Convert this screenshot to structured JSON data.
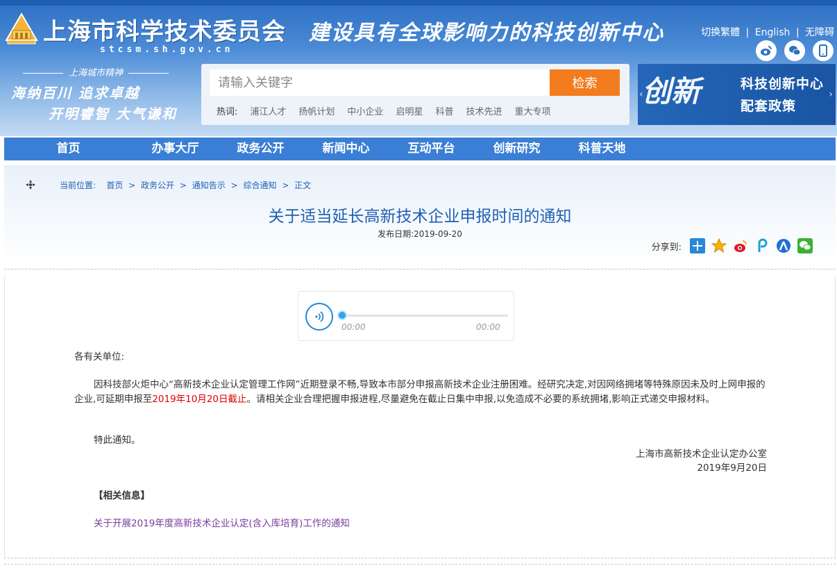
{
  "header": {
    "site_title": "上海市科学技术委员会",
    "site_url": "stcsm.sh.gov.cn",
    "slogan": "建设具有全球影响力的科技创新中心",
    "lang_links": [
      "切换繁體",
      "English",
      "无障碍"
    ],
    "lang_separator": "|",
    "spirit_label": "上海城市精神",
    "spirit_line1": "海纳百川 追求卓越",
    "spirit_line2": "开明睿智 大气谦和"
  },
  "search": {
    "placeholder": "请输入关键字",
    "button_label": "检索",
    "hot_label": "热词:",
    "hot_words": [
      "浦江人才",
      "扬帆计划",
      "中小企业",
      "启明星",
      "科普",
      "技术先进",
      "重大专项"
    ]
  },
  "banner": {
    "art_text": "创新",
    "line1": "科技创新中心",
    "line2": "配套政策"
  },
  "nav": {
    "items": [
      "首页",
      "办事大厅",
      "政务公开",
      "新闻中心",
      "互动平台",
      "创新研究",
      "科普天地"
    ]
  },
  "breadcrumb": {
    "label": "当前位置:",
    "items": [
      "首页",
      "政务公开",
      "通知告示",
      "综合通知",
      "正文"
    ],
    "separator": ">"
  },
  "article": {
    "title": "关于适当延长高新技术企业申报时间的通知",
    "publish_date": "发布日期:2019-09-20",
    "share_label": "分享到:",
    "greeting": "各有关单位:",
    "body_before": "因科技部火炬中心“高新技术企业认定管理工作网”近期登录不畅,导致本市部分申报高新技术企业注册困难。经研究决定,对因网络拥堵等特殊原因未及时上网申报的企业,可延期申报至",
    "body_deadline": "2019年10月20日截止",
    "body_after": "。请相关企业合理把握申报进程,尽量避免在截止日集中申报,以免造成不必要的系统拥堵,影响正式递交申报材料。",
    "closing": "特此通知。",
    "signoff_org": "上海市高新技术企业认定办公室",
    "signoff_date": "2019年9月20日",
    "related_heading": "【相关信息】",
    "related_link": "关于开展2019年度高新技术企业认定(含入库培育)工作的通知"
  },
  "audio": {
    "current_time": "00:00",
    "duration": "00:00",
    "progress": 0
  },
  "colors": {
    "header_blue": "#2d6fc2",
    "nav_blue": "#3a7fd5",
    "search_orange": "#f27c1e",
    "title_blue": "#1f5fb5",
    "deadline_red": "#e00000",
    "link_purple": "#7b3b9e"
  }
}
